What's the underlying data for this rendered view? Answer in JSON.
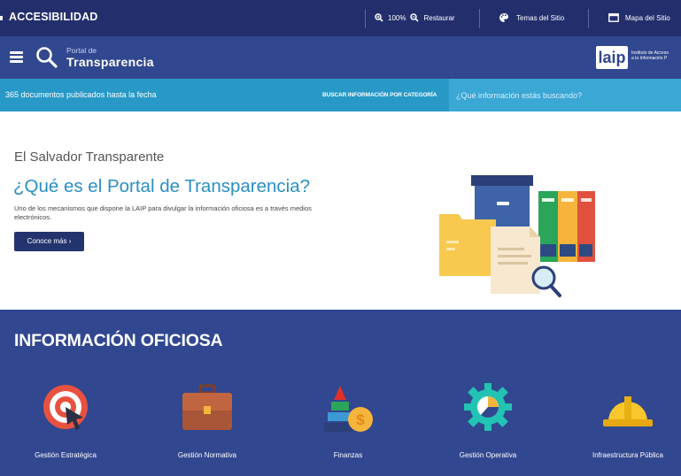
{
  "topbar": {
    "title": "ACCESIBILIDAD",
    "zoom_value": "100%",
    "restore_label": "Restaurar",
    "themes_label": "Temas del Sitio",
    "sitemap_label": "Mapa del Sitio"
  },
  "header": {
    "portal_sub": "Portal de",
    "portal_main": "Transparencia",
    "logo_word": "laip",
    "logo_tagline_1": "Instituto de Acceso",
    "logo_tagline_2": "a la Información P"
  },
  "strip": {
    "doc_count": "365 documentos publicados hasta la fecha",
    "category_label": "BUSCAR INFORMACIÓN POR CATEGORÍA",
    "search_placeholder": "¿Qué información estás buscando?"
  },
  "hero": {
    "kicker": "El Salvador Transparente",
    "title": "¿Qué es el Portal de Transparencia?",
    "description": "Uno de los mecanismos que dispone la LAIP para divulgar la información oficiosa es a través medios electrónicos.",
    "button_label": "Conoce más ›"
  },
  "oficiosa": {
    "title": "INFORMACIÓN OFICIOSA",
    "categories": [
      {
        "label": "Gestión Estratégica",
        "icon": "target-icon"
      },
      {
        "label": "Gestión Normativa",
        "icon": "briefcase-icon"
      },
      {
        "label": "Finanzas",
        "icon": "finance-icon"
      },
      {
        "label": "Gestión Operativa",
        "icon": "gear-chart-icon"
      },
      {
        "label": "Infraestructura Pública",
        "icon": "hardhat-icon"
      }
    ]
  },
  "colors": {
    "topbar": "#232f6d",
    "header": "#31478f",
    "strip": "#2899c7",
    "accent_title": "#2a8fc4"
  }
}
